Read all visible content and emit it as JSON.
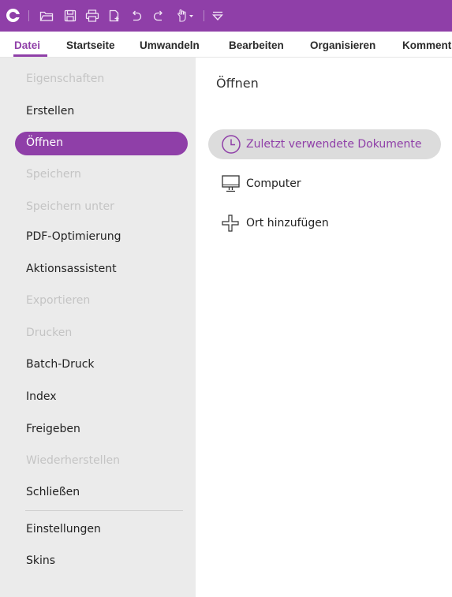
{
  "toolbar": {
    "icons": [
      "app-logo-icon",
      "open-folder-icon",
      "save-icon",
      "print-icon",
      "new-document-icon",
      "undo-icon",
      "redo-icon",
      "hand-tool-icon",
      "customize-toolbar-icon"
    ]
  },
  "menubar": {
    "tabs": [
      "Datei",
      "Startseite",
      "Umwandeln",
      "Bearbeiten",
      "Organisieren",
      "Komment"
    ],
    "active_tab": "Datei"
  },
  "sidebar": {
    "items": [
      {
        "label": "Eigenschaften",
        "state": "disabled"
      },
      {
        "label": "Erstellen",
        "state": "enabled"
      },
      {
        "label": "Öffnen",
        "state": "selected"
      },
      {
        "label": "Speichern",
        "state": "disabled"
      },
      {
        "label": "Speichern unter",
        "state": "disabled"
      },
      {
        "label": "PDF-Optimierung",
        "state": "enabled"
      },
      {
        "label": "Aktionsassistent",
        "state": "enabled"
      },
      {
        "label": "Exportieren",
        "state": "disabled"
      },
      {
        "label": "Drucken",
        "state": "disabled"
      },
      {
        "label": "Batch-Druck",
        "state": "enabled"
      },
      {
        "label": "Index",
        "state": "enabled"
      },
      {
        "label": "Freigeben",
        "state": "enabled"
      },
      {
        "label": "Wiederherstellen",
        "state": "disabled"
      },
      {
        "label": "Schließen",
        "state": "enabled"
      },
      {
        "label": "Einstellungen",
        "state": "enabled"
      },
      {
        "label": "Skins",
        "state": "enabled"
      }
    ]
  },
  "main": {
    "title": "Öffnen",
    "options": [
      {
        "label": "Zuletzt verwendete Dokumente",
        "icon": "clock-icon",
        "selected": true
      },
      {
        "label": "Computer",
        "icon": "monitor-icon",
        "selected": false
      },
      {
        "label": "Ort hinzufügen",
        "icon": "plus-icon",
        "selected": false
      }
    ]
  },
  "colors": {
    "accent": "#8f3fa8",
    "sidebar_bg": "#ebebeb",
    "disabled_text": "#c4c4c4",
    "option_selected_bg": "#dcdcdc"
  }
}
